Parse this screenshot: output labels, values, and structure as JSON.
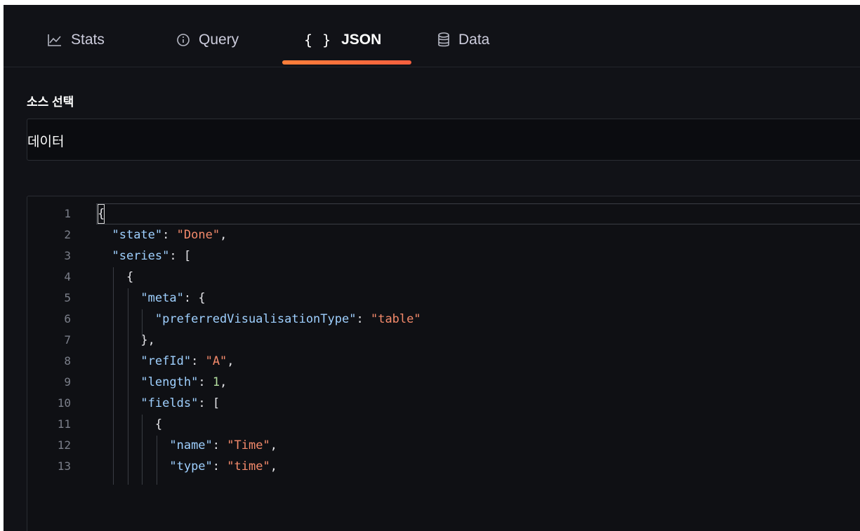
{
  "tabs": [
    {
      "label": "Stats",
      "icon": "chart-line-icon"
    },
    {
      "label": "Query",
      "icon": "info-circle-icon"
    },
    {
      "label": "JSON",
      "icon": "braces-icon",
      "icon_glyph": "{ }"
    },
    {
      "label": "Data",
      "icon": "database-icon"
    }
  ],
  "active_tab": "JSON",
  "accent_color": "#f55f3e",
  "source": {
    "label": "소스 선택",
    "value": "데이터"
  },
  "editor": {
    "line_numbers": [
      "1",
      "2",
      "3",
      "4",
      "5",
      "6",
      "7",
      "8",
      "9",
      "10",
      "11",
      "12",
      "13"
    ],
    "lines": [
      "{",
      "  \"state\": \"Done\",",
      "  \"series\": [",
      "    {",
      "      \"meta\": {",
      "        \"preferredVisualisationType\": \"table\"",
      "      },",
      "      \"refId\": \"A\",",
      "      \"length\": 1,",
      "      \"fields\": [",
      "        {",
      "          \"name\": \"Time\",",
      "          \"type\": \"time\","
    ]
  }
}
